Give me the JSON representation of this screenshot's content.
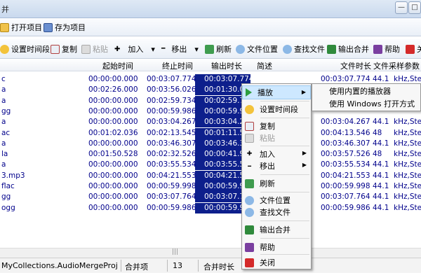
{
  "window": {
    "title": "并",
    "min_glyph": "—",
    "max_glyph": "□"
  },
  "toolbar1": {
    "open_project": "打开项目",
    "save_as_project": "存为项目"
  },
  "toolbar2": {
    "set_time_range": "设置时间段",
    "copy": "复制",
    "paste": "粘贴",
    "add": "加入",
    "remove": "移出",
    "refresh": "刷新",
    "file_location": "文件位置",
    "find_file": "查找文件",
    "output_merge": "输出合并",
    "help": "帮助",
    "close": "关"
  },
  "columns": {
    "start": "起始时间",
    "end": "终止时间",
    "output_duration": "输出时长",
    "description": "简述",
    "file_duration": "文件时长",
    "sample_params": "文件采样参数"
  },
  "rows": [
    {
      "name": "c",
      "start": "00:00:00.000",
      "end": "00:03:07.774",
      "out": "00:03:07.774",
      "fdur": "00:03:07.774",
      "rate": "44.1",
      "params": "kHz,Stere"
    },
    {
      "name": "a",
      "start": "00:02:26.000",
      "end": "00:03:56.026",
      "out": "00:01:30.0",
      "fdur": "",
      "rate": "",
      "params": ""
    },
    {
      "name": "a",
      "start": "00:00:00.000",
      "end": "00:02:59.734",
      "out": "00:02:59.7",
      "fdur": "",
      "rate": "",
      "params": ""
    },
    {
      "name": "gg",
      "start": "00:00:00.000",
      "end": "00:00:59.986",
      "out": "00:00:59.9",
      "fdur": "",
      "rate": "",
      "params": ""
    },
    {
      "name": "a",
      "start": "00:00:00.000",
      "end": "00:03:04.267",
      "out": "00:03:04.2",
      "fdur": "00:03:04.267",
      "rate": "44.1",
      "params": "kHz,Stere"
    },
    {
      "name": "ac",
      "start": "00:01:02.036",
      "end": "00:02:13.545",
      "out": "00:01:11.5",
      "fdur": "00:04:13.546",
      "rate": "48",
      "params": "kHz,Stere"
    },
    {
      "name": "a",
      "start": "00:00:00.000",
      "end": "00:03:46.307",
      "out": "00:03:46.3",
      "fdur": "00:03:46.307",
      "rate": "44.1",
      "params": "kHz,Stere"
    },
    {
      "name": "la",
      "start": "00:01:50.528",
      "end": "00:02:32.526",
      "out": "00:00:41.9",
      "fdur": "00:03:57.526",
      "rate": "48",
      "params": "kHz,Stere"
    },
    {
      "name": "a",
      "start": "00:00:00.000",
      "end": "00:03:55.534",
      "out": "00:03:55.5",
      "fdur": "00:03:55.534",
      "rate": "44.1",
      "params": "kHz,Stere"
    },
    {
      "name": "3.mp3",
      "start": "00:00:00.000",
      "end": "00:04:21.553",
      "out": "00:04:21.5",
      "fdur": "00:04:21.553",
      "rate": "44.1",
      "params": "kHz,Stere"
    },
    {
      "name": "flac",
      "start": "00:00:00.000",
      "end": "00:00:59.998",
      "out": "00:00:59.9",
      "fdur": "00:00:59.998",
      "rate": "44.1",
      "params": "kHz,Stere"
    },
    {
      "name": "gg",
      "start": "00:00:00.000",
      "end": "00:03:07.764",
      "out": "00:03:07.7",
      "fdur": "00:03:07.764",
      "rate": "44.1",
      "params": "kHz,Stere"
    },
    {
      "name": "ogg",
      "start": "00:00:00.000",
      "end": "00:00:59.986",
      "out": "00:00:59.9",
      "fdur": "00:00:59.986",
      "rate": "44.1",
      "params": "kHz,Stere"
    }
  ],
  "scroll_grip": "|||",
  "status": {
    "project": "MyCollections.AudioMergeProj",
    "items_label": "合并项",
    "items_count": "13",
    "total_label": "合并时长"
  },
  "context_menu": {
    "play": "播放",
    "set_time_range": "设置时间段",
    "copy": "复制",
    "paste": "粘贴",
    "add": "加入",
    "remove": "移出",
    "refresh": "刷新",
    "file_location": "文件位置",
    "find_file": "查找文件",
    "output_merge": "输出合并",
    "help": "帮助",
    "close": "关闭",
    "arrow": "▶"
  },
  "submenu": {
    "builtin_player": "使用内置的播放器",
    "windows_open_with": "使用 Windows 打开方式"
  },
  "toolbar_arrows": {
    "dropdown": "▾",
    "plus": "✚",
    "minus": "━"
  },
  "colors": {
    "selection": "#0d1f8c",
    "row_text": "#00008b",
    "highlight": "#cde8ff"
  }
}
